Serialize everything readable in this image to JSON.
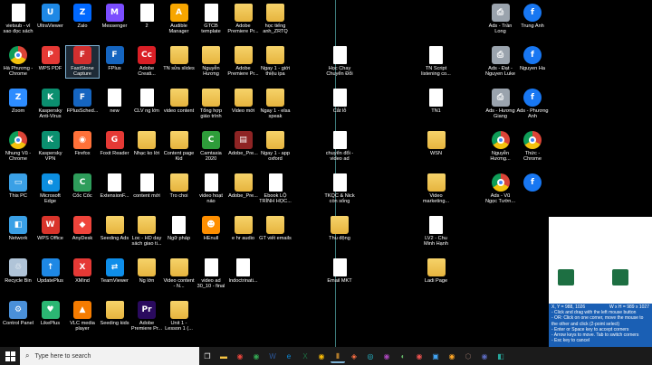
{
  "desktop": {
    "icons": [
      {
        "label": "vietsub - vì sao đọc sách",
        "color": "#ffffff",
        "kind": "doc",
        "col": 0,
        "row": 0
      },
      {
        "label": "Hà Phương - Chrome",
        "color": "",
        "kind": "chrome",
        "col": 0,
        "row": 1
      },
      {
        "label": "Zoom",
        "color": "#2d8cff",
        "kind": "plain",
        "glyph": "Z",
        "col": 0,
        "row": 2
      },
      {
        "label": "Nhung Vũ - Chrome",
        "color": "",
        "kind": "chrome",
        "col": 0,
        "row": 3
      },
      {
        "label": "This PC",
        "color": "#3aa0e6",
        "kind": "plain",
        "glyph": "▭",
        "col": 0,
        "row": 4
      },
      {
        "label": "Network",
        "color": "#3aa0e6",
        "kind": "plain",
        "glyph": "◧",
        "col": 0,
        "row": 5
      },
      {
        "label": "Recycle Bin",
        "color": "#b0c4d8",
        "kind": "plain",
        "glyph": "♲",
        "col": 0,
        "row": 6
      },
      {
        "label": "Control Panel",
        "color": "#4a90d9",
        "kind": "plain",
        "glyph": "⚙",
        "col": 0,
        "row": 7
      },
      {
        "label": "UltraViewer",
        "color": "#1e88e5",
        "kind": "plain",
        "glyph": "U",
        "col": 1,
        "row": 0
      },
      {
        "label": "WPS PDF",
        "color": "#e53935",
        "kind": "plain",
        "glyph": "P",
        "col": 1,
        "row": 1
      },
      {
        "label": "Kaspersky Anti-Virus",
        "color": "#0b8f6f",
        "kind": "plain",
        "glyph": "K",
        "col": 1,
        "row": 2
      },
      {
        "label": "Kaspersky VPN",
        "color": "#0b8f6f",
        "kind": "plain",
        "glyph": "K",
        "col": 1,
        "row": 3
      },
      {
        "label": "Microsoft Edge",
        "color": "#0c8ee0",
        "kind": "plain",
        "glyph": "e",
        "col": 1,
        "row": 4
      },
      {
        "label": "WPS Office",
        "color": "#d9342b",
        "kind": "plain",
        "glyph": "W",
        "col": 1,
        "row": 5
      },
      {
        "label": "UpdatePlus",
        "color": "#1e88e5",
        "kind": "plain",
        "glyph": "↑",
        "col": 1,
        "row": 6
      },
      {
        "label": "LikePlus",
        "color": "#2bb673",
        "kind": "plain",
        "glyph": "♥",
        "col": 1,
        "row": 7
      },
      {
        "label": "Zalo",
        "color": "#0068ff",
        "kind": "plain",
        "glyph": "Z",
        "col": 2,
        "row": 0
      },
      {
        "label": "FastStone Capture",
        "color": "#d32f2f",
        "kind": "plain",
        "glyph": "F",
        "col": 2,
        "row": 1,
        "selected": true
      },
      {
        "label": "FPlusSched...",
        "color": "#1565c0",
        "kind": "plain",
        "glyph": "F",
        "col": 2,
        "row": 2
      },
      {
        "label": "Firefox",
        "color": "#ff7139",
        "kind": "plain",
        "glyph": "◉",
        "col": 2,
        "row": 3
      },
      {
        "label": "Cốc Cốc",
        "color": "#2e9d5b",
        "kind": "plain",
        "glyph": "C",
        "col": 2,
        "row": 4
      },
      {
        "label": "AnyDesk",
        "color": "#ef443b",
        "kind": "plain",
        "glyph": "◆",
        "col": 2,
        "row": 5
      },
      {
        "label": "XMind",
        "color": "#e53935",
        "kind": "plain",
        "glyph": "X",
        "col": 2,
        "row": 6
      },
      {
        "label": "VLC media player",
        "color": "#f57c00",
        "kind": "plain",
        "glyph": "▲",
        "col": 2,
        "row": 7
      },
      {
        "label": "Messenger",
        "color": "#7b4dff",
        "kind": "plain",
        "glyph": "M",
        "col": 3,
        "row": 0
      },
      {
        "label": "FPlus",
        "color": "#1565c0",
        "kind": "plain",
        "glyph": "F",
        "col": 3,
        "row": 1
      },
      {
        "label": "new",
        "color": "#ffffff",
        "kind": "doc",
        "col": 3,
        "row": 2
      },
      {
        "label": "Foxit Reader",
        "color": "#e53935",
        "kind": "plain",
        "glyph": "G",
        "col": 3,
        "row": 3
      },
      {
        "label": "ExtensionF...",
        "color": "#ffffff",
        "kind": "doc",
        "col": 3,
        "row": 4
      },
      {
        "label": "Seeding Ads",
        "color": "",
        "kind": "folder",
        "col": 3,
        "row": 5
      },
      {
        "label": "TeamViewer",
        "color": "#0e8ee9",
        "kind": "plain",
        "glyph": "⇄",
        "col": 3,
        "row": 6
      },
      {
        "label": "Seeding kids",
        "color": "",
        "kind": "folder",
        "col": 3,
        "row": 7
      },
      {
        "label": "2",
        "color": "#ffffff",
        "kind": "doc",
        "col": 4,
        "row": 0
      },
      {
        "label": "Adobe Creati...",
        "color": "#da1f26",
        "kind": "plain",
        "glyph": "Cc",
        "col": 4,
        "row": 1
      },
      {
        "label": "CLV ng lớn",
        "color": "#ffffff",
        "kind": "doc",
        "col": 4,
        "row": 2
      },
      {
        "label": "Nhạc ko lời",
        "color": "",
        "kind": "folder",
        "col": 4,
        "row": 3
      },
      {
        "label": "content mới",
        "color": "#ffffff",
        "kind": "doc",
        "col": 4,
        "row": 4
      },
      {
        "label": "Loc - HD day sách giao ti...",
        "color": "",
        "kind": "folder",
        "col": 4,
        "row": 5
      },
      {
        "label": "Ng lớn",
        "color": "",
        "kind": "folder",
        "col": 4,
        "row": 6
      },
      {
        "label": "Adobe Premiere Pr...",
        "color": "#2a0a5e",
        "kind": "plain",
        "glyph": "Pr",
        "col": 4,
        "row": 7
      },
      {
        "label": "Audible Manager",
        "color": "#f7a600",
        "kind": "plain",
        "glyph": "A",
        "col": 5,
        "row": 0
      },
      {
        "label": "TN sửa slides",
        "color": "",
        "kind": "folder",
        "col": 5,
        "row": 1
      },
      {
        "label": "video content",
        "color": "",
        "kind": "folder",
        "col": 5,
        "row": 2
      },
      {
        "label": "Content page Kid",
        "color": "",
        "kind": "folder",
        "col": 5,
        "row": 3
      },
      {
        "label": "Tro choi",
        "color": "",
        "kind": "folder",
        "col": 5,
        "row": 4
      },
      {
        "label": "Ngữ pháp",
        "color": "#ffffff",
        "kind": "doc",
        "col": 5,
        "row": 5
      },
      {
        "label": "Video content - N...",
        "color": "",
        "kind": "folder",
        "col": 5,
        "row": 6
      },
      {
        "label": "Unit 1 - Lesson 1 (...",
        "color": "",
        "kind": "folder",
        "col": 5,
        "row": 7
      },
      {
        "label": "GTCB template",
        "color": "#ffffff",
        "kind": "doc",
        "col": 6,
        "row": 0
      },
      {
        "label": "Nguyễn Hương",
        "color": "",
        "kind": "folder",
        "col": 6,
        "row": 1
      },
      {
        "label": "Tổng hợp giáo trình",
        "color": "",
        "kind": "folder",
        "col": 6,
        "row": 2
      },
      {
        "label": "Camtasia 2020",
        "color": "#2e9d3a",
        "kind": "plain",
        "glyph": "C",
        "col": 6,
        "row": 3
      },
      {
        "label": "video hoạt náo",
        "color": "#ffffff",
        "kind": "doc",
        "col": 6,
        "row": 4
      },
      {
        "label": "HEnull",
        "color": "#ff8f00",
        "kind": "plain",
        "glyph": "☻",
        "col": 6,
        "row": 5
      },
      {
        "label": "video ad 30_10 - final",
        "color": "#ffffff",
        "kind": "doc",
        "col": 6,
        "row": 6
      },
      {
        "label": "Adobe Premiere Pr...",
        "color": "",
        "kind": "folder",
        "col": 7,
        "row": 0
      },
      {
        "label": "Adobe Premiere Pr...",
        "color": "",
        "kind": "folder",
        "col": 7,
        "row": 1
      },
      {
        "label": "Video mới",
        "color": "",
        "kind": "folder",
        "col": 7,
        "row": 2
      },
      {
        "label": "Adobe_Pre...",
        "color": "#8e2424",
        "kind": "plain",
        "glyph": "▤",
        "col": 7,
        "row": 3
      },
      {
        "label": "Adobe_Pre...",
        "color": "",
        "kind": "folder",
        "col": 7,
        "row": 4
      },
      {
        "label": "e hr audio",
        "color": "",
        "kind": "folder",
        "col": 7,
        "row": 5
      },
      {
        "label": "Indoctrinati...",
        "color": "#ffffff",
        "kind": "doc",
        "col": 7,
        "row": 6
      },
      {
        "label": "học tiếng anh_ZRTQ",
        "color": "",
        "kind": "folder",
        "col": 8,
        "row": 0
      },
      {
        "label": "Ngay 1 - giới thiệu ipa",
        "color": "",
        "kind": "folder",
        "col": 8,
        "row": 1
      },
      {
        "label": "Ngay 1 - elsa speak",
        "color": "",
        "kind": "folder",
        "col": 8,
        "row": 2
      },
      {
        "label": "Ngay 1 - app oxford",
        "color": "",
        "kind": "folder",
        "col": 8,
        "row": 3
      },
      {
        "label": "Ebook LỘ TRÌNH HỌC...",
        "color": "#ffffff",
        "kind": "doc",
        "col": 8,
        "row": 4
      },
      {
        "label": "GT viết emails",
        "color": "",
        "kind": "folder",
        "col": 8,
        "row": 5
      },
      {
        "label": "Học Chay Chuyển Đổi",
        "color": "#ffffff",
        "kind": "doc",
        "col": 10,
        "row": 1
      },
      {
        "label": "Cắt lỗ",
        "color": "#ffffff",
        "kind": "doc",
        "col": 10,
        "row": 2
      },
      {
        "label": "chuyển đổi - video ad",
        "color": "#ffffff",
        "kind": "doc",
        "col": 10,
        "row": 3
      },
      {
        "label": "TKQC & Nick còn sống",
        "color": "#ffffff",
        "kind": "doc",
        "col": 10,
        "row": 4
      },
      {
        "label": "Thu động",
        "color": "",
        "kind": "folder",
        "col": 10,
        "row": 5
      },
      {
        "label": "Email MKT",
        "color": "#ffffff",
        "kind": "doc",
        "col": 10,
        "row": 6
      },
      {
        "label": "TN Script listening co...",
        "color": "#ffffff",
        "kind": "doc",
        "col": 13,
        "row": 1
      },
      {
        "label": "TN1",
        "color": "#ffffff",
        "kind": "doc",
        "col": 13,
        "row": 2
      },
      {
        "label": "WSN",
        "color": "",
        "kind": "folder",
        "col": 13,
        "row": 3
      },
      {
        "label": "Video marketing...",
        "color": "",
        "kind": "folder",
        "col": 13,
        "row": 4
      },
      {
        "label": "LV2 - Chu Minh Hạnh",
        "color": "#ffffff",
        "kind": "doc",
        "col": 13,
        "row": 5
      },
      {
        "label": "Ladi Page",
        "color": "",
        "kind": "folder",
        "col": 13,
        "row": 6
      },
      {
        "label": "Ads - Trần Long",
        "color": "",
        "kind": "printer",
        "col": 15,
        "row": 0
      },
      {
        "label": "Ads - Đạt - Nguyen Luke",
        "color": "",
        "kind": "printer",
        "col": 15,
        "row": 1
      },
      {
        "label": "Ads - Hương Giang",
        "color": "",
        "kind": "printer",
        "col": 15,
        "row": 2
      },
      {
        "label": "Nguyễn Hương...",
        "color": "",
        "kind": "chrome",
        "col": 15,
        "row": 3
      },
      {
        "label": "Ads - Vũ Ngọc Tườn...",
        "color": "",
        "kind": "chrome",
        "col": 15,
        "row": 4
      },
      {
        "label": "Trung Anh",
        "color": "",
        "kind": "fb",
        "col": 16,
        "row": 0
      },
      {
        "label": "Nguyen Ha",
        "color": "",
        "kind": "fb",
        "col": 16,
        "row": 1
      },
      {
        "label": "Ads - Phương Anh",
        "color": "",
        "kind": "fb",
        "col": 16,
        "row": 2
      },
      {
        "label": "Thức - Chrome",
        "color": "",
        "kind": "chrome",
        "col": 16,
        "row": 3
      },
      {
        "label": "",
        "color": "",
        "kind": "fb",
        "col": 16,
        "row": 4
      }
    ]
  },
  "capture_panel": {
    "coords": "X, Y = 988, 1026",
    "size": "W x H = 989 x 1027",
    "lines": [
      "- Click and drag with the left mouse button",
      "- OR: Click on one corner, move the mouse to the other and click (2-point select)",
      "- Enter or Space key to accept corners",
      "- Arrow keys to move. Tab to switch corners",
      "- Esc key to cancel"
    ]
  },
  "taskbar": {
    "search_placeholder": "Type here to search",
    "apps": [
      {
        "name": "task-view",
        "glyph": "❐",
        "color": "#ffffff"
      },
      {
        "name": "file-explorer",
        "glyph": "▬",
        "color": "#f6c443"
      },
      {
        "name": "chrome",
        "glyph": "◉",
        "color": "#e8453c"
      },
      {
        "name": "chrome-2",
        "glyph": "◉",
        "color": "#34a853"
      },
      {
        "name": "word",
        "glyph": "W",
        "color": "#2b579a"
      },
      {
        "name": "edge",
        "glyph": "e",
        "color": "#0c8ee0"
      },
      {
        "name": "excel",
        "glyph": "X",
        "color": "#1d6f42"
      },
      {
        "name": "chrome-3",
        "glyph": "◉",
        "color": "#fbbc05"
      },
      {
        "name": "running-app",
        "glyph": "▮",
        "color": "#b07a2a"
      },
      {
        "name": "app-a",
        "glyph": "◈",
        "color": "#ff7043"
      },
      {
        "name": "app-b",
        "glyph": "◎",
        "color": "#26c6da"
      },
      {
        "name": "app-c",
        "glyph": "◉",
        "color": "#ab47bc"
      },
      {
        "name": "app-d",
        "glyph": "◐",
        "color": "#66bb6a"
      },
      {
        "name": "app-e",
        "glyph": "◉",
        "color": "#ef5350"
      },
      {
        "name": "app-f",
        "glyph": "▣",
        "color": "#42a5f5"
      },
      {
        "name": "app-g",
        "glyph": "◉",
        "color": "#ffa726"
      },
      {
        "name": "app-h",
        "glyph": "⬡",
        "color": "#8d6e63"
      },
      {
        "name": "app-i",
        "glyph": "◉",
        "color": "#5c6bc0"
      },
      {
        "name": "app-j",
        "glyph": "◧",
        "color": "#26a69a"
      }
    ]
  }
}
